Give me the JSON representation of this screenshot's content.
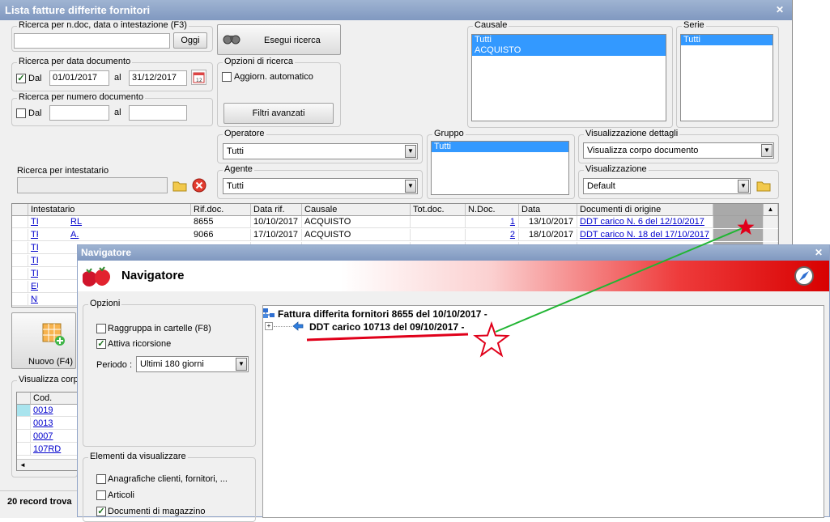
{
  "main": {
    "title": "Lista fatture differite fornitori",
    "search_text": {
      "legend": "Ricerca per n.doc, data o intestazione (F3)",
      "value": "",
      "ok_label": "Oggi"
    },
    "search_button_label": "Esegui ricerca",
    "date_search": {
      "legend": "Ricerca per data documento",
      "dal_label": "Dal",
      "dal_checked": true,
      "from": "01/01/2017",
      "al_label": "al",
      "to": "31/12/2017"
    },
    "number_search": {
      "legend": "Ricerca per numero documento",
      "dal_label": "Dal",
      "al_label": "al"
    },
    "search_options": {
      "legend": "Opzioni di ricerca",
      "auto_label": "Aggiorn. automatico",
      "advanced_label": "Filtri avanzati"
    },
    "causale": {
      "legend": "Causale",
      "items": [
        "Tutti",
        "ACQUISTO"
      ]
    },
    "serie": {
      "legend": "Serie",
      "items": [
        "Tutti"
      ]
    },
    "operatore": {
      "legend": "Operatore",
      "value": "Tutti"
    },
    "agente": {
      "legend": "Agente",
      "value": "Tutti"
    },
    "gruppo": {
      "legend": "Gruppo",
      "items": [
        "Tutti"
      ]
    },
    "dettagli": {
      "legend": "Visualizzazione dettagli",
      "value": "Visualizza corpo documento"
    },
    "visualizzazione": {
      "legend": "Visualizzazione",
      "value": "Default"
    },
    "intestatario": {
      "legend": "Ricerca per intestatario"
    },
    "grid": {
      "columns": [
        "Intestatario",
        "Rif.doc.",
        "Data rif.",
        "Causale",
        "Tot.doc.",
        "N.Doc.",
        "Data",
        "Documenti di origine"
      ],
      "rows": [
        {
          "intestatario": "TI",
          "intestatario_tail": "RL",
          "rif": "8655",
          "data_rif": "10/10/2017",
          "causale": "ACQUISTO",
          "ndoc": "1",
          "data": "13/10/2017",
          "origine": "DDT carico N. 6 del 12/10/2017"
        },
        {
          "intestatario": "TF",
          "intestatario_tail": "A.",
          "rif": "9066",
          "data_rif": "17/10/2017",
          "causale": "ACQUISTO",
          "ndoc": "2",
          "data": "18/10/2017",
          "origine": "DDT carico N. 18 del 17/10/2017"
        },
        {
          "intestatario": "TI"
        },
        {
          "intestatario": "TI"
        },
        {
          "intestatario": "TI"
        },
        {
          "intestatario": "EU"
        },
        {
          "intestatario": "NU"
        }
      ]
    },
    "new_button_label": "Nuovo (F4)",
    "body_view": {
      "legend": "Visualizza corpo",
      "column": "Cod.",
      "rows": [
        "0019",
        "0013",
        "0007",
        "107RD"
      ]
    },
    "status": "20 record trova"
  },
  "navigator": {
    "title": "Navigatore",
    "header_title": "Navigatore",
    "options": {
      "legend": "Opzioni",
      "group_label": "Raggruppa in cartelle (F8)",
      "group_checked": false,
      "recursion_label": "Attiva ricorsione",
      "recursion_checked": true,
      "period_label": "Periodo :",
      "period_value": "Ultimi 180 giorni"
    },
    "elements": {
      "legend": "Elementi da visualizzare",
      "items": [
        {
          "label": "Anagrafiche clienti, fornitori, ...",
          "checked": false
        },
        {
          "label": "Articoli",
          "checked": false
        },
        {
          "label": "Documenti di magazzino",
          "checked": true
        }
      ]
    },
    "tree": {
      "root": "Fattura differita fornitori 8655 del 10/10/2017 -",
      "child": "DDT carico 10713 del 09/10/2017 -",
      "expander": "+"
    }
  },
  "colors": {
    "title_bar": "#8ea4c8",
    "selection": "#3399ff",
    "annotation_red": "#e0001a",
    "annotation_green": "#21b533"
  }
}
